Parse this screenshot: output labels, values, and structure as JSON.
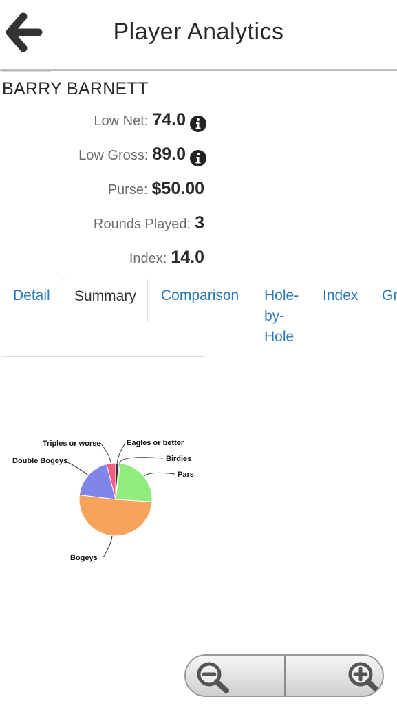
{
  "header": {
    "title": "Player Analytics",
    "back_icon": "arrow-left-icon"
  },
  "player": {
    "name": "BARRY BARNETT"
  },
  "stats": [
    {
      "label": "Low Net:",
      "value": "74.0",
      "info": true
    },
    {
      "label": "Low Gross:",
      "value": "89.0",
      "info": true
    },
    {
      "label": "Purse:",
      "value": "$50.00",
      "info": false
    },
    {
      "label": "Rounds Played:",
      "value": "3",
      "info": false
    },
    {
      "label": "Index:",
      "value": "14.0",
      "info": false
    }
  ],
  "tabs": [
    {
      "label": "Detail",
      "active": false
    },
    {
      "label": "Summary",
      "active": true
    },
    {
      "label": "Comparison",
      "active": false
    },
    {
      "label": "Hole-\nby-\nHole",
      "active": false
    },
    {
      "label": "Index",
      "active": false
    },
    {
      "label": "Gr",
      "active": false
    }
  ],
  "chart_data": {
    "type": "pie",
    "title": "",
    "slices": [
      {
        "label": "Eagles or better",
        "value": 1.5,
        "color": "#333333"
      },
      {
        "label": "Birdies",
        "value": 0.5,
        "color": "#666666"
      },
      {
        "label": "Pars",
        "value": 24,
        "color": "#90ed7d"
      },
      {
        "label": "Bogeys",
        "value": 51,
        "color": "#f7a35c"
      },
      {
        "label": "Double Bogeys",
        "value": 19,
        "color": "#8085e9"
      },
      {
        "label": "Triples or worse",
        "value": 4,
        "color": "#f15c80"
      }
    ]
  },
  "zoom": {
    "out_icon": "zoom-out-icon",
    "in_icon": "zoom-in-icon"
  }
}
